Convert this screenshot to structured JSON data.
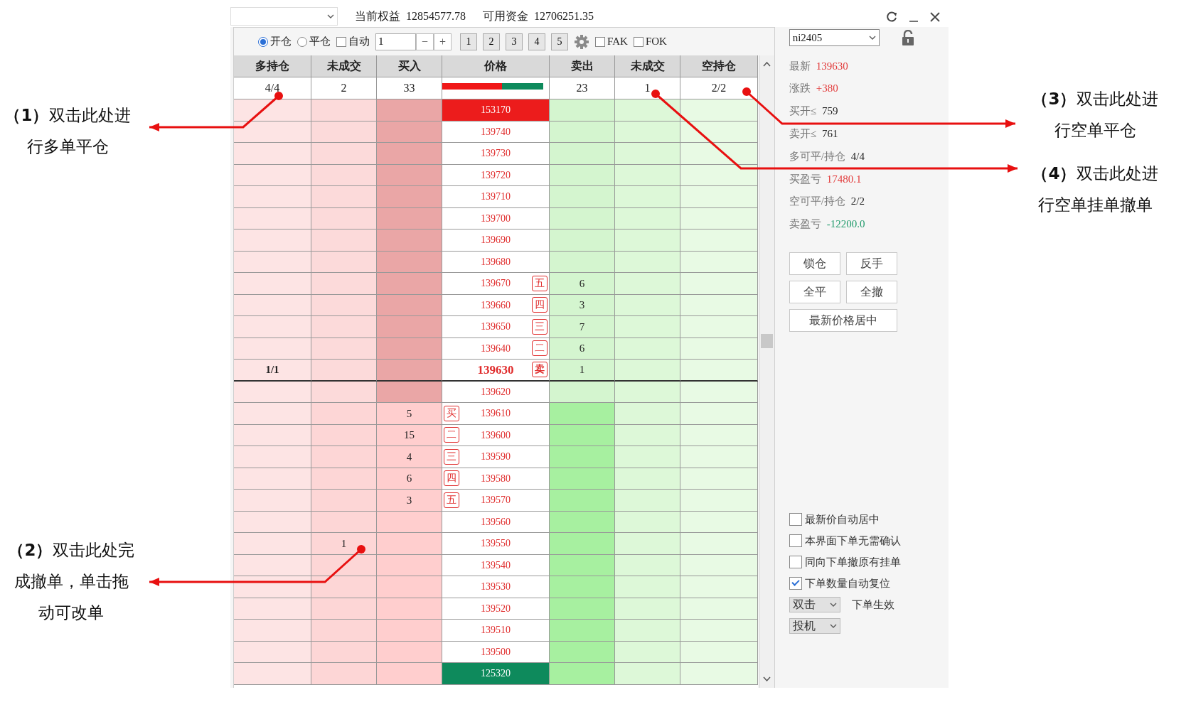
{
  "account": {
    "balance_label": "当前权益",
    "balance": "12854577.78",
    "available_label": "可用资金",
    "available": "12706251.35"
  },
  "toolbar": {
    "modes": [
      {
        "label": "开仓",
        "selected": true
      },
      {
        "label": "平仓",
        "selected": false
      }
    ],
    "auto": {
      "label": "自动",
      "checked": false
    },
    "quantity": "1",
    "minus": "−",
    "plus": "+",
    "presets": [
      "1",
      "2",
      "3",
      "4",
      "5"
    ],
    "flags": [
      {
        "label": "FAK",
        "checked": false
      },
      {
        "label": "FOK",
        "checked": false
      }
    ]
  },
  "table": {
    "columns": [
      "多持仓",
      "未成交",
      "买入",
      "价格",
      "卖出",
      "未成交",
      "空持仓"
    ],
    "summary": {
      "long_position": "4/4",
      "long_pending": "2",
      "bid_total": "33",
      "level": 0.59,
      "ask_total": "23",
      "short_pending": "1",
      "short_position": "2/2"
    },
    "rows": [
      {
        "bid_side": false,
        "kind": "high",
        "price": "153170"
      },
      {
        "bid_side": false,
        "kind": "normal",
        "price": "139740"
      },
      {
        "bid_side": false,
        "kind": "normal",
        "price": "139730"
      },
      {
        "bid_side": false,
        "kind": "normal",
        "price": "139720"
      },
      {
        "bid_side": false,
        "kind": "normal",
        "price": "139710"
      },
      {
        "bid_side": false,
        "kind": "normal",
        "price": "139700"
      },
      {
        "bid_side": false,
        "kind": "normal",
        "price": "139690"
      },
      {
        "bid_side": false,
        "kind": "normal",
        "price": "139680"
      },
      {
        "bid_side": false,
        "kind": "normal",
        "price": "139670",
        "ask_tag": "五",
        "ask": "6"
      },
      {
        "bid_side": false,
        "kind": "normal",
        "price": "139660",
        "ask_tag": "四",
        "ask": "3"
      },
      {
        "bid_side": false,
        "kind": "normal",
        "price": "139650",
        "ask_tag": "三",
        "ask": "7"
      },
      {
        "bid_side": false,
        "kind": "normal",
        "price": "139640",
        "ask_tag": "二",
        "ask": "6"
      },
      {
        "bid_side": false,
        "kind": "last",
        "price": "139630",
        "ask_tag": "卖",
        "ask": "1",
        "long_position": "1/1"
      },
      {
        "bid_side": false,
        "kind": "normal",
        "price": "139620"
      },
      {
        "bid_side": true,
        "kind": "normal",
        "price": "139610",
        "bid_tag": "买",
        "bid": "5"
      },
      {
        "bid_side": true,
        "kind": "normal",
        "price": "139600",
        "bid_tag": "二",
        "bid": "15"
      },
      {
        "bid_side": true,
        "kind": "normal",
        "price": "139590",
        "bid_tag": "三",
        "bid": "4"
      },
      {
        "bid_side": true,
        "kind": "normal",
        "price": "139580",
        "bid_tag": "四",
        "bid": "6"
      },
      {
        "bid_side": true,
        "kind": "normal",
        "price": "139570",
        "bid_tag": "五",
        "bid": "3"
      },
      {
        "bid_side": true,
        "kind": "normal",
        "price": "139560"
      },
      {
        "bid_side": true,
        "kind": "normal",
        "price": "139550",
        "long_pending": "1"
      },
      {
        "bid_side": true,
        "kind": "normal",
        "price": "139540"
      },
      {
        "bid_side": true,
        "kind": "normal",
        "price": "139530"
      },
      {
        "bid_side": true,
        "kind": "normal",
        "price": "139520"
      },
      {
        "bid_side": true,
        "kind": "normal",
        "price": "139510"
      },
      {
        "bid_side": true,
        "kind": "normal",
        "price": "139500"
      },
      {
        "bid_side": true,
        "kind": "low",
        "price": "125320"
      }
    ]
  },
  "panel": {
    "contract": "ni2405",
    "stats": [
      {
        "label": "最新",
        "value": "139630",
        "color": "#e23a3a"
      },
      {
        "label": "涨跌",
        "value": "+380",
        "color": "#e23a3a"
      },
      {
        "label": "买开≤",
        "value": "759",
        "color": "#222222"
      },
      {
        "label": "卖开≤",
        "value": "761",
        "color": "#222222"
      },
      {
        "label": "多可平/持仓",
        "value": "4/4",
        "color": "#222222"
      },
      {
        "label": "买盈亏",
        "value": "17480.1",
        "color": "#e23a3a"
      },
      {
        "label": "空可平/持仓",
        "value": "2/2",
        "color": "#222222"
      },
      {
        "label": "卖盈亏",
        "value": "-12200.0",
        "color": "#1f9a6a"
      }
    ],
    "buttons": [
      [
        "锁仓",
        "反手"
      ],
      [
        "全平",
        "全撤"
      ],
      [
        "最新价格居中"
      ]
    ],
    "options": [
      {
        "label": "最新价自动居中",
        "checked": false
      },
      {
        "label": "本界面下单无需确认",
        "checked": false
      },
      {
        "label": "同向下单撤原有挂单",
        "checked": false
      },
      {
        "label": "下单数量自动复位",
        "checked": true
      }
    ],
    "trigger": {
      "value": "双击",
      "label": "下单生效"
    },
    "hedge": "投机"
  },
  "annotations": [
    {
      "lines": [
        "**（1）**双击此处进",
        "行多单平仓"
      ]
    },
    {
      "lines": [
        "**（2）**双击此处完",
        "成撤单，单击拖",
        "动可改单"
      ]
    },
    {
      "lines": [
        "**（3）**双击此处进",
        "行空单平仓"
      ]
    },
    {
      "lines": [
        "**（4）**双击此处进",
        "行空单挂单撤单"
      ]
    }
  ]
}
